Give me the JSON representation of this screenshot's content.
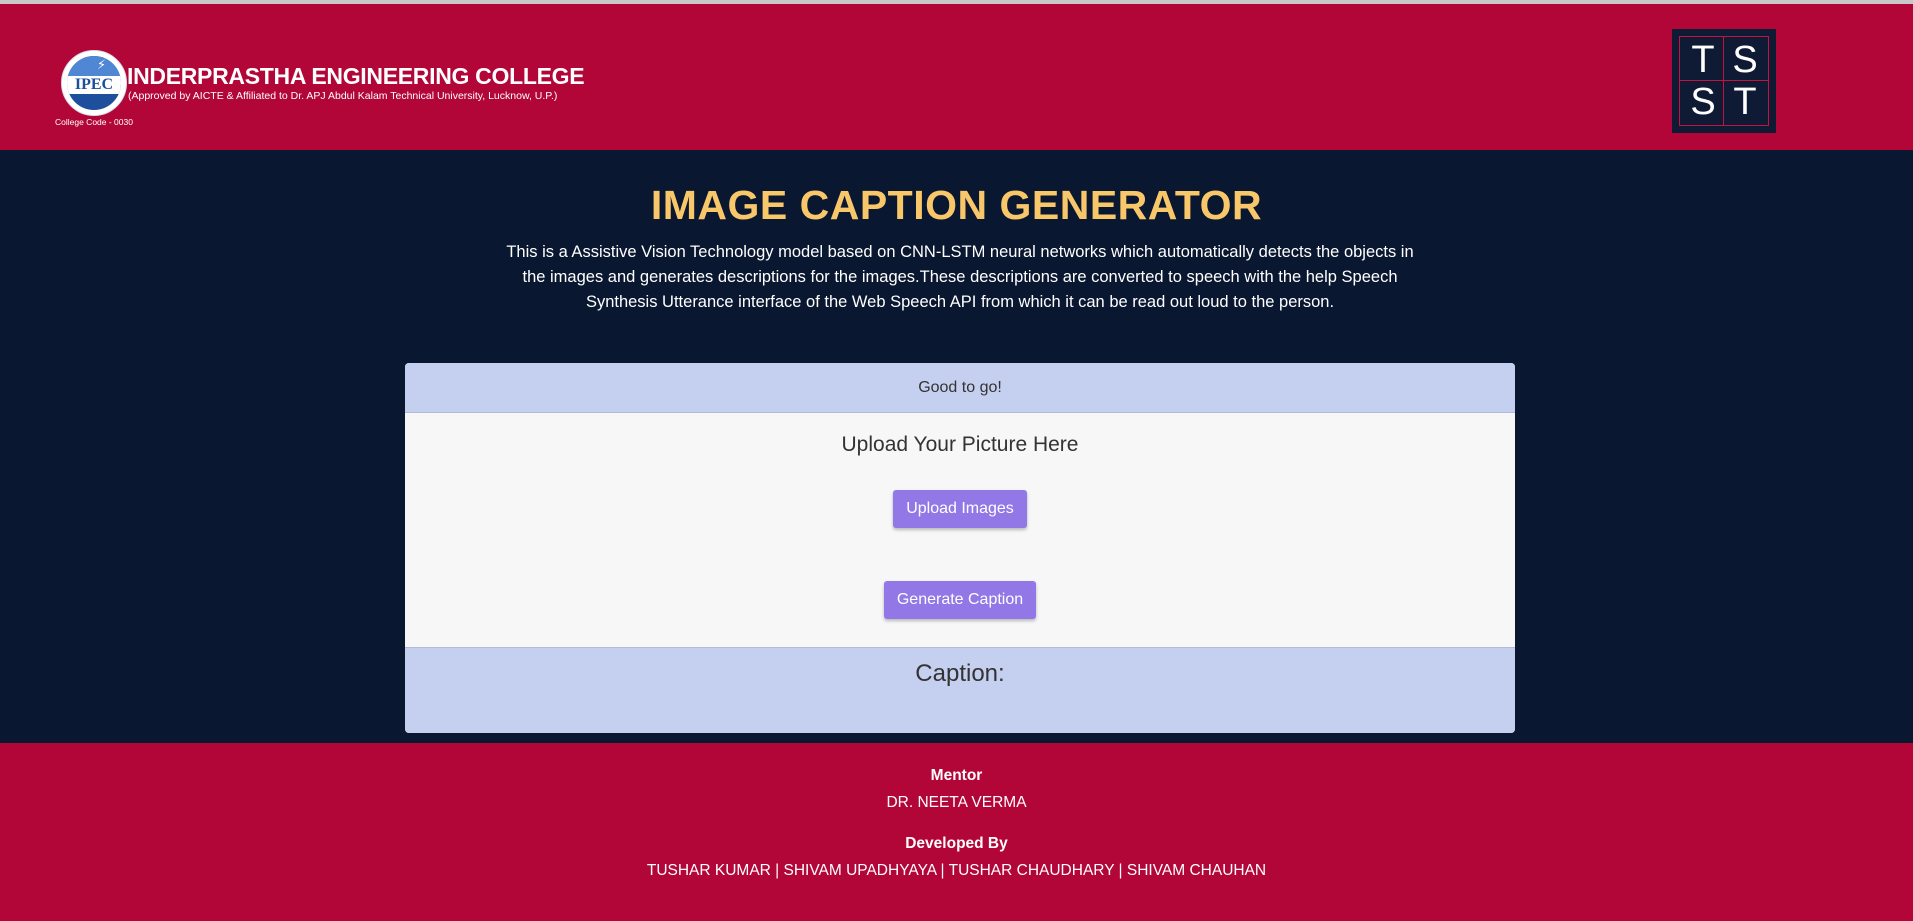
{
  "header": {
    "logo": {
      "abbr": "IPEC",
      "name": "INDERPRASTHA ENGINEERING COLLEGE",
      "subtitle": "(Approved by AICTE & Affiliated to Dr. APJ Abdul Kalam Technical University, Lucknow, U.P.)",
      "code": "College Code - 0030",
      "colors": {
        "circle": "#1e4f9c",
        "text": "#ffffff"
      }
    },
    "badge": {
      "letters": [
        "T",
        "S",
        "S",
        "T"
      ],
      "color_bg": "#0f1a34",
      "color_grid": "#c4133e"
    },
    "color_bg": "#b30638"
  },
  "main": {
    "title": "IMAGE CAPTION GENERATOR",
    "description": "This is a Assistive Vision Technology model based on CNN-LSTM neural networks which automatically detects the objects in the images and generates descriptions for the images.These descriptions are converted to speech with the help Speech Synthesis Utterance interface of the Web Speech API from which it can be read out loud to the person.",
    "color_bg": "#0a1730",
    "color_title": "#f8c76a"
  },
  "card": {
    "status": "Good to go!",
    "upload_title": "Upload Your Picture Here",
    "upload_button": "Upload Images",
    "generate_button": "Generate Caption",
    "caption_label": "Caption:",
    "caption_text": "",
    "color_band": "#c5cfef",
    "color_button": "#9178e6"
  },
  "footer": {
    "mentor_label": "Mentor",
    "mentor_name": "DR. NEETA VERMA",
    "developed_label": "Developed By",
    "developers": "TUSHAR KUMAR | SHIVAM UPADHYAYA | TUSHAR CHAUDHARY | SHIVAM CHAUHAN",
    "color_bg": "#b30638"
  }
}
